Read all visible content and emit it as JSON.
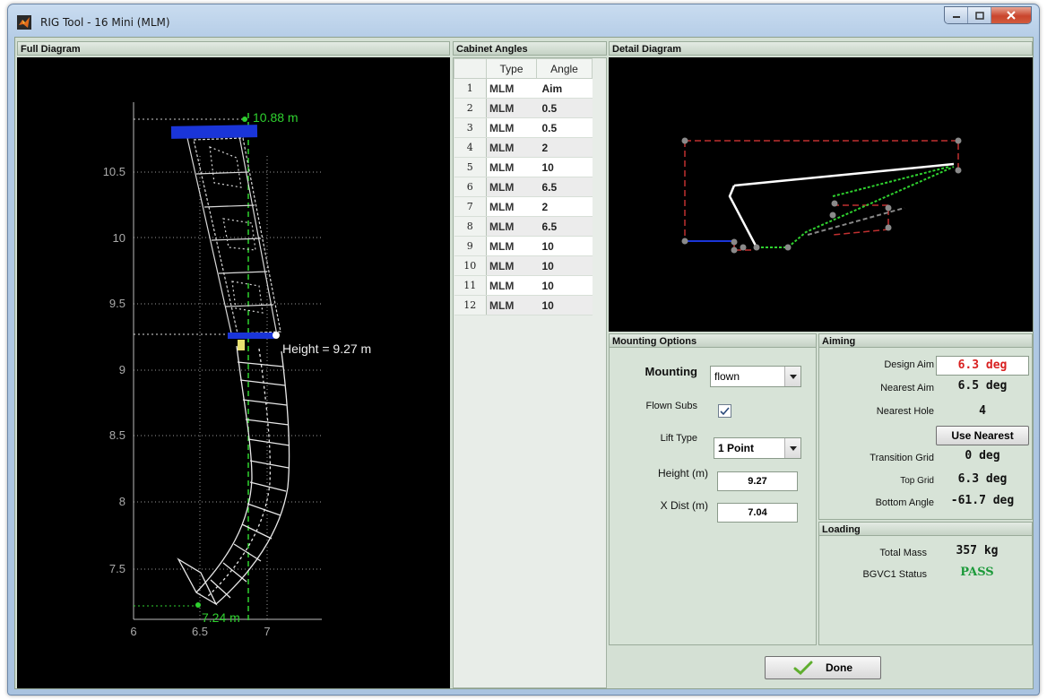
{
  "window": {
    "title": "RIG Tool - 16 Mini (MLM)"
  },
  "panels": {
    "full_diagram": "Full Diagram",
    "cabinet_angles": "Cabinet Angles",
    "detail_diagram": "Detail Diagram",
    "mounting_options": "Mounting Options",
    "aiming": "Aiming",
    "loading": "Loading"
  },
  "full_diagram": {
    "y_ticks": [
      "10.5",
      "10",
      "9.5",
      "9",
      "8.5",
      "8",
      "7.5"
    ],
    "x_ticks": [
      "6",
      "6.5",
      "7"
    ],
    "top_label": "10.88 m",
    "height_label": "Height = 9.27 m",
    "bottom_label": "7.24 m"
  },
  "cabinet_table": {
    "headers": [
      "Type",
      "Angle"
    ],
    "rows": [
      {
        "n": "1",
        "type": "MLM",
        "angle": "Aim"
      },
      {
        "n": "2",
        "type": "MLM",
        "angle": "0.5"
      },
      {
        "n": "3",
        "type": "MLM",
        "angle": "0.5"
      },
      {
        "n": "4",
        "type": "MLM",
        "angle": "2"
      },
      {
        "n": "5",
        "type": "MLM",
        "angle": "10"
      },
      {
        "n": "6",
        "type": "MLM",
        "angle": "6.5"
      },
      {
        "n": "7",
        "type": "MLM",
        "angle": "2"
      },
      {
        "n": "8",
        "type": "MLM",
        "angle": "6.5"
      },
      {
        "n": "9",
        "type": "MLM",
        "angle": "10"
      },
      {
        "n": "10",
        "type": "MLM",
        "angle": "10"
      },
      {
        "n": "11",
        "type": "MLM",
        "angle": "10"
      },
      {
        "n": "12",
        "type": "MLM",
        "angle": "10"
      }
    ]
  },
  "mounting": {
    "mounting_label": "Mounting",
    "mounting_value": "flown",
    "flown_subs_label": "Flown Subs",
    "flown_subs_checked": true,
    "lift_type_label": "Lift Type",
    "lift_type_value": "1 Point",
    "height_label": "Height (m)",
    "height_value": "9.27",
    "xdist_label": "X Dist (m)",
    "xdist_value": "7.04"
  },
  "aiming": {
    "design_aim_label": "Design Aim",
    "design_aim_value": "6.3 deg",
    "nearest_aim_label": "Nearest Aim",
    "nearest_aim_value": "6.5 deg",
    "nearest_hole_label": "Nearest Hole",
    "nearest_hole_value": "4",
    "use_nearest_label": "Use Nearest",
    "transition_grid_label": "Transition Grid",
    "transition_grid_value": "0 deg",
    "top_grid_label": "Top Grid",
    "top_grid_value": "6.3 deg",
    "bottom_angle_label": "Bottom Angle",
    "bottom_angle_value": "-61.7 deg"
  },
  "loading": {
    "total_mass_label": "Total Mass",
    "total_mass_value": "357 kg",
    "status_label": "BGVC1 Status",
    "status_value": "PASS"
  },
  "done_label": "Done",
  "colors": {
    "status_pass": "#1c9a3a",
    "design_aim": "#d92020",
    "grid_line": "#2fd12f",
    "rig_frame": "#1a35d8"
  }
}
